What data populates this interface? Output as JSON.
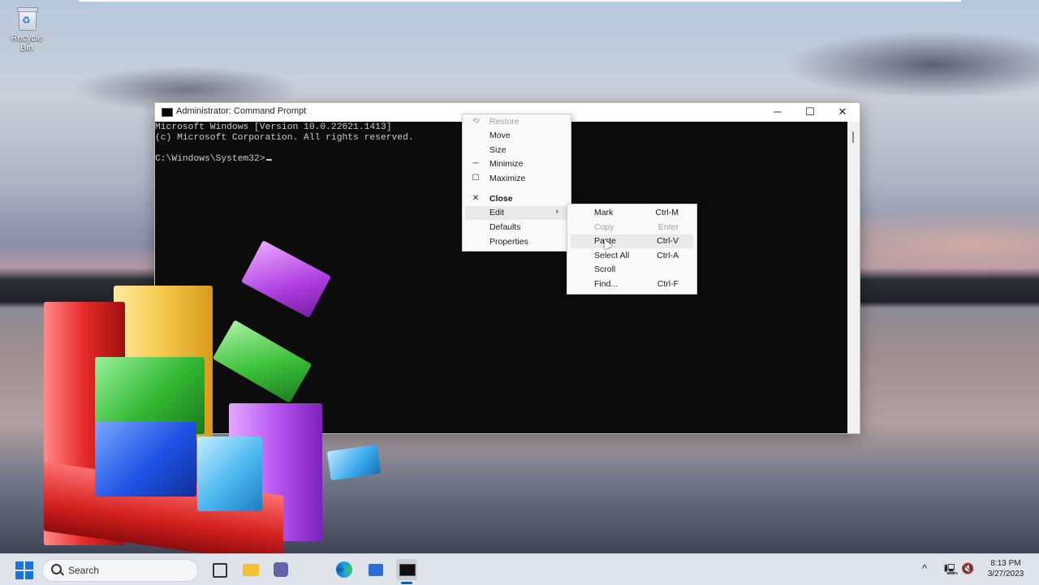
{
  "desktop": {
    "icons": [
      {
        "label": "Recycle Bin",
        "icon": "recycle-bin-icon"
      }
    ]
  },
  "window": {
    "title": "Administrator: Command Prompt",
    "controls": {
      "minimize": "─",
      "maximize": "☐",
      "close": "✕"
    },
    "console_lines": [
      "Microsoft Windows [Version 10.0.22621.1413]",
      "(c) Microsoft Corporation. All rights reserved.",
      "",
      "C:\\Windows\\System32>"
    ]
  },
  "system_menu": {
    "items": [
      {
        "label": "Restore",
        "icon": "restore-icon",
        "glyph": "⟲",
        "disabled": true
      },
      {
        "label": "Move"
      },
      {
        "label": "Size"
      },
      {
        "label": "Minimize",
        "icon": "minimize-icon",
        "glyph": "─"
      },
      {
        "label": "Maximize",
        "icon": "maximize-icon",
        "glyph": "☐"
      },
      {
        "label": "Close",
        "icon": "close-icon",
        "glyph": "✕",
        "bold": true
      },
      {
        "label": "Edit",
        "submenu": true,
        "highlighted": true
      },
      {
        "label": "Defaults"
      },
      {
        "label": "Properties"
      }
    ]
  },
  "edit_menu": {
    "items": [
      {
        "label": "Mark",
        "shortcut": "Ctrl-M"
      },
      {
        "label": "Copy",
        "shortcut": "Enter",
        "disabled": true
      },
      {
        "label": "Paste",
        "shortcut": "Ctrl-V",
        "highlighted": true
      },
      {
        "label": "Select All",
        "shortcut": "Ctrl-A"
      },
      {
        "label": "Scroll",
        "shortcut": ""
      },
      {
        "label": "Find...",
        "shortcut": "Ctrl-F"
      }
    ]
  },
  "taskbar": {
    "search_label": "Search",
    "apps": [
      "start-icon",
      "search-icon",
      "widgets-icon",
      "file-explorer-icon",
      "teams-icon",
      "edge-icon",
      "store-icon",
      "terminal-icon"
    ],
    "tray": {
      "chevron": "^",
      "time": "8:13 PM",
      "date": "3/27/2023"
    }
  },
  "colors": {
    "console_bg": "#0c0c0c",
    "console_text": "#cccccc",
    "accent": "#0067c0"
  }
}
